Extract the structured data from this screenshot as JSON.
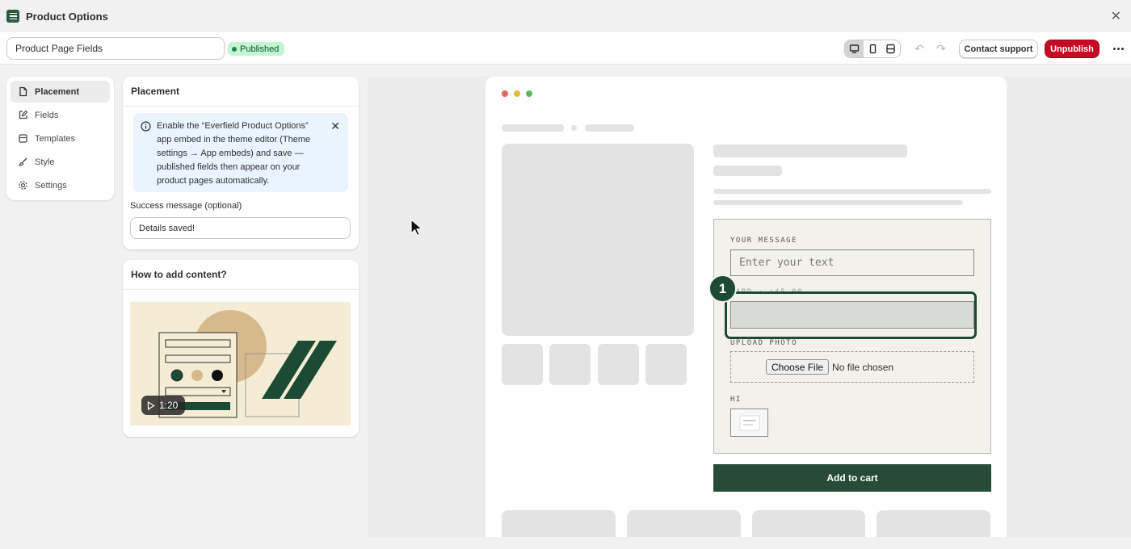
{
  "app": {
    "title": "Product Options",
    "close_icon": "close-icon"
  },
  "toolbar": {
    "name_value": "Product Page Fields",
    "status_badge": "Published",
    "view_modes": [
      "desktop",
      "mobile",
      "fullscreen"
    ],
    "active_view": "desktop",
    "contact_support": "Contact support",
    "unpublish": "Unpublish"
  },
  "sidebar": {
    "items": [
      {
        "label": "Placement",
        "icon": "document-icon",
        "active": true
      },
      {
        "label": "Fields",
        "icon": "edit-icon",
        "active": false
      },
      {
        "label": "Templates",
        "icon": "template-icon",
        "active": false
      },
      {
        "label": "Style",
        "icon": "brush-icon",
        "active": false
      },
      {
        "label": "Settings",
        "icon": "gear-icon",
        "active": false
      }
    ]
  },
  "placement": {
    "title": "Placement",
    "banner_text": "Enable the “Everfield Product Options” app embed in the theme editor (Theme settings → App embeds) and save — published fields then appear on your product pages automatically.",
    "success_label": "Success message (optional)",
    "success_value": "Details saved!"
  },
  "howto": {
    "title": "How to add content?",
    "video_duration": "1:20"
  },
  "preview": {
    "fields": {
      "message_label": "YOUR MESSAGE",
      "message_placeholder": "Enter your text",
      "card_label": "CARD · +$5.00",
      "upload_label": "UPLOAD PHOTO",
      "choose_file": "Choose File",
      "no_file": "No file chosen",
      "hi_label": "HI"
    },
    "step_number": "1",
    "add_to_cart": "Add to cart"
  },
  "colors": {
    "brand_green": "#264b36",
    "unpublish_red": "#c70a24",
    "published_badge_bg": "#c4f5d1",
    "info_banner_bg": "#eaf4ff"
  }
}
